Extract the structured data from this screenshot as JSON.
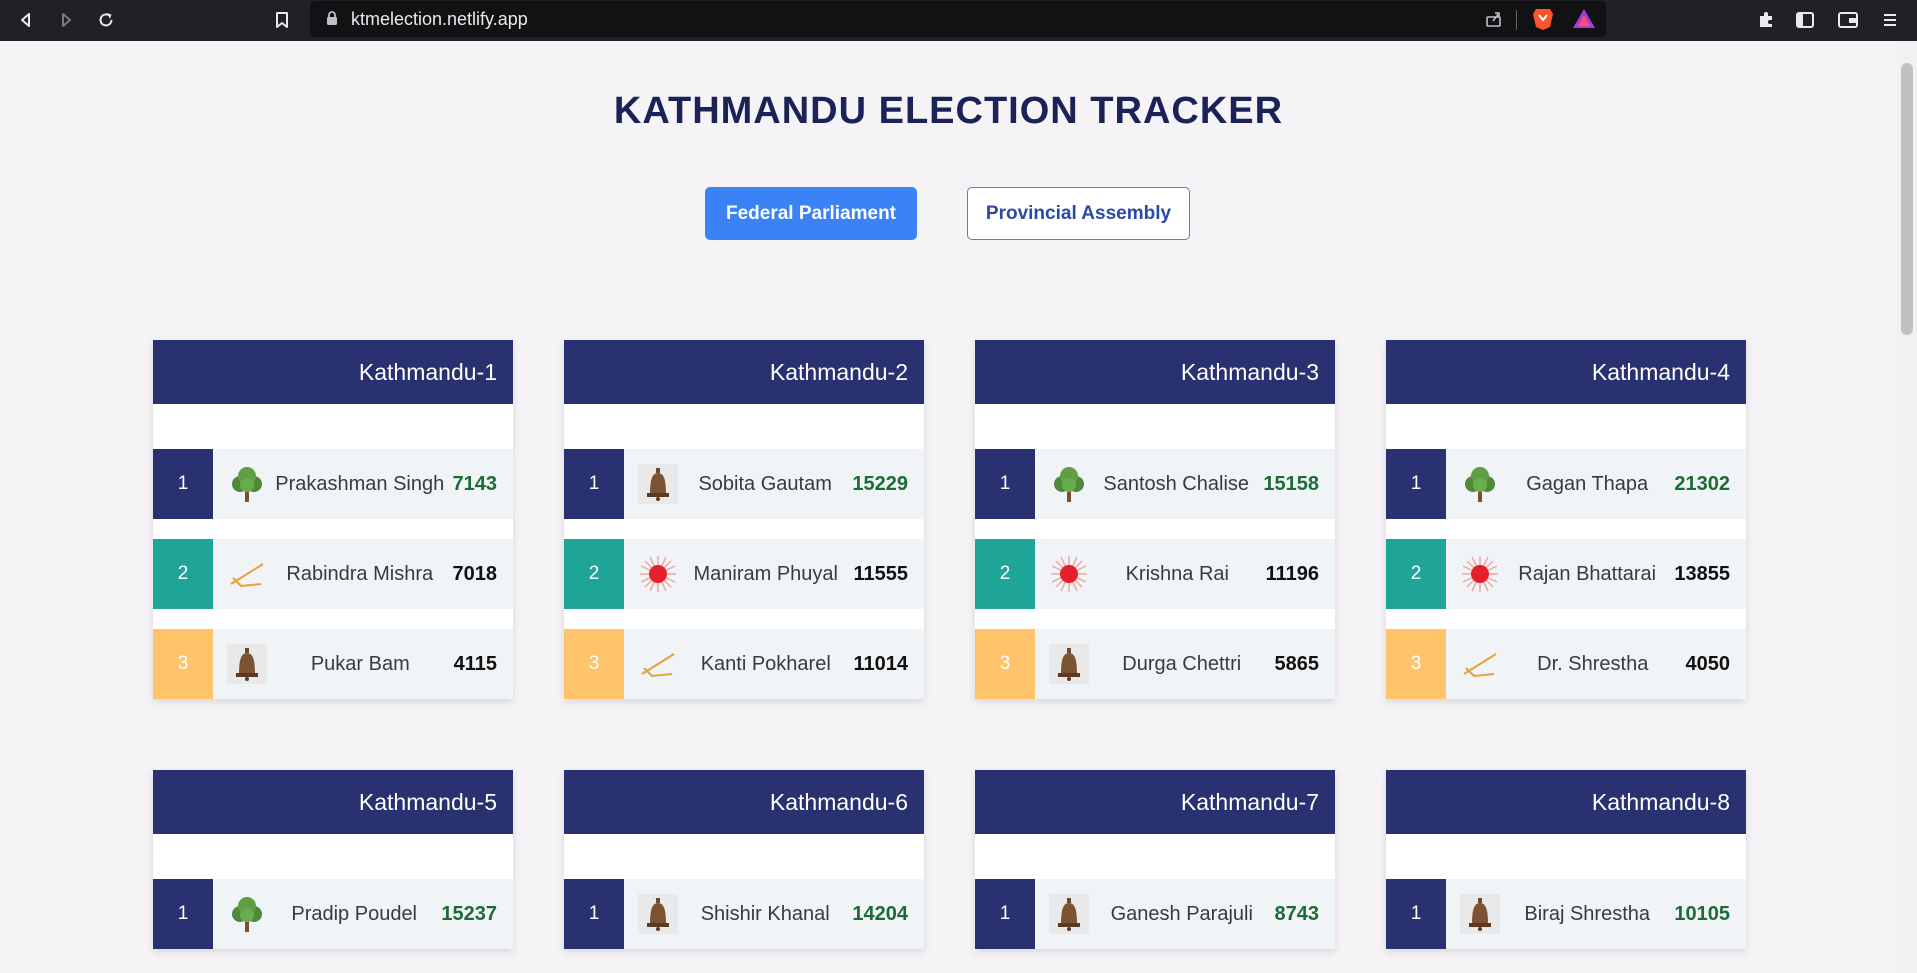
{
  "browser": {
    "url": "ktmelection.netlify.app"
  },
  "page": {
    "title": "KATHMANDU ELECTION TRACKER",
    "tabs": [
      {
        "label": "Federal Parliament",
        "active": true
      },
      {
        "label": "Provincial Assembly",
        "active": false
      }
    ]
  },
  "colors": {
    "header": "#293170",
    "rank1": "#293170",
    "rank2": "#1fa597",
    "rank3": "#ffc46b",
    "active_tab": "#3b82f6",
    "lead_votes": "#1d6b34"
  },
  "constituencies": [
    {
      "name": "Kathmandu-1",
      "candidates": [
        {
          "rank": "1",
          "symbol": "tree-icon",
          "name": "Prakashman Singh",
          "votes": "7143"
        },
        {
          "rank": "2",
          "symbol": "sickle-icon",
          "name": "Rabindra Mishra",
          "votes": "7018"
        },
        {
          "rank": "3",
          "symbol": "bell-icon",
          "name": "Pukar Bam",
          "votes": "4115"
        }
      ]
    },
    {
      "name": "Kathmandu-2",
      "candidates": [
        {
          "rank": "1",
          "symbol": "bell-icon",
          "name": "Sobita Gautam",
          "votes": "15229"
        },
        {
          "rank": "2",
          "symbol": "sun-icon",
          "name": "Maniram Phuyal",
          "votes": "11555"
        },
        {
          "rank": "3",
          "symbol": "sickle-icon",
          "name": "Kanti Pokharel",
          "votes": "11014"
        }
      ]
    },
    {
      "name": "Kathmandu-3",
      "candidates": [
        {
          "rank": "1",
          "symbol": "tree-icon",
          "name": "Santosh Chalise",
          "votes": "15158"
        },
        {
          "rank": "2",
          "symbol": "sun-icon",
          "name": "Krishna Rai",
          "votes": "11196"
        },
        {
          "rank": "3",
          "symbol": "bell-icon",
          "name": "Durga Chettri",
          "votes": "5865"
        }
      ]
    },
    {
      "name": "Kathmandu-4",
      "candidates": [
        {
          "rank": "1",
          "symbol": "tree-icon",
          "name": "Gagan Thapa",
          "votes": "21302"
        },
        {
          "rank": "2",
          "symbol": "sun-icon",
          "name": "Rajan Bhattarai",
          "votes": "13855"
        },
        {
          "rank": "3",
          "symbol": "sickle-icon",
          "name": "Dr. Shrestha",
          "votes": "4050"
        }
      ]
    },
    {
      "name": "Kathmandu-5",
      "candidates": [
        {
          "rank": "1",
          "symbol": "tree-icon",
          "name": "Pradip Poudel",
          "votes": "15237"
        }
      ]
    },
    {
      "name": "Kathmandu-6",
      "candidates": [
        {
          "rank": "1",
          "symbol": "bell-icon",
          "name": "Shishir Khanal",
          "votes": "14204"
        }
      ]
    },
    {
      "name": "Kathmandu-7",
      "candidates": [
        {
          "rank": "1",
          "symbol": "bell-icon",
          "name": "Ganesh Parajuli",
          "votes": "8743"
        }
      ]
    },
    {
      "name": "Kathmandu-8",
      "candidates": [
        {
          "rank": "1",
          "symbol": "bell-icon",
          "name": "Biraj Shrestha",
          "votes": "10105"
        }
      ]
    }
  ]
}
